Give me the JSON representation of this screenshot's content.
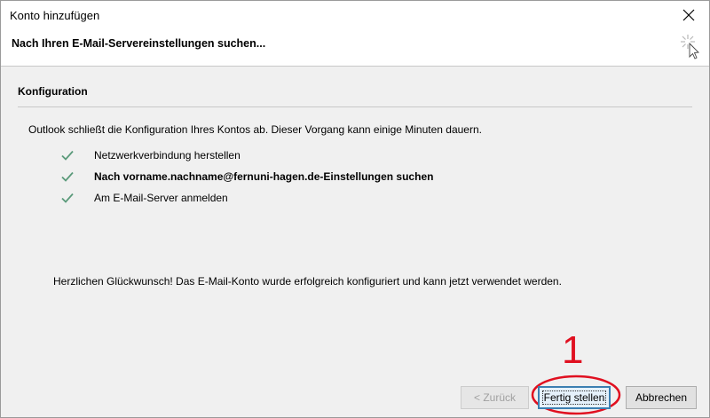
{
  "window": {
    "title": "Konto hinzufügen"
  },
  "header": {
    "title": "Nach Ihren E-Mail-Servereinstellungen suchen..."
  },
  "section": {
    "title": "Konfiguration"
  },
  "intro_text": "Outlook schließt die Konfiguration Ihres Kontos ab. Dieser Vorgang kann einige Minuten dauern.",
  "steps": [
    {
      "label": "Netzwerkverbindung herstellen",
      "status": "done"
    },
    {
      "label": "Nach vorname.nachname@fernuni-hagen.de-Einstellungen suchen",
      "status": "done"
    },
    {
      "label": "Am E-Mail-Server anmelden",
      "status": "done"
    }
  ],
  "success_text": "Herzlichen Glückwunsch! Das E-Mail-Konto wurde erfolgreich konfiguriert und kann jetzt verwendet werden.",
  "buttons": {
    "back": "< Zurück",
    "finish": "Fertig stellen",
    "cancel": "Abbrechen"
  },
  "annotation": {
    "number": "1"
  },
  "colors": {
    "check": "#5a9a7a",
    "annotation": "#e01020",
    "focus": "#3c7fb1"
  },
  "icons": {
    "close": "close-icon",
    "spinner": "spinner-icon",
    "check": "check-icon"
  }
}
